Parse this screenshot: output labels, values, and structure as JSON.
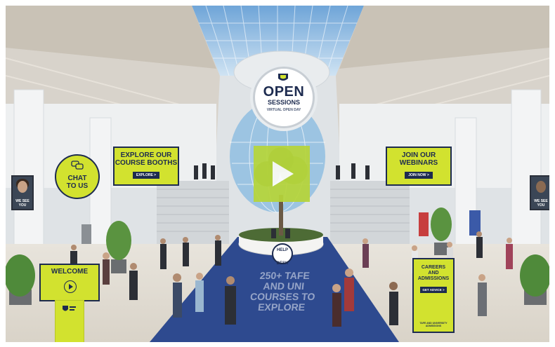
{
  "hub_sign": {
    "title": "OPEN",
    "subtitle": "SESSIONS",
    "tagline": "VIRTUAL OPEN DAY"
  },
  "video": {
    "icon": "play-icon"
  },
  "banners": {
    "explore": {
      "title_line1": "EXPLORE OUR",
      "title_line2": "COURSE BOOTHS",
      "button": "EXPLORE >"
    },
    "webinars": {
      "title_line1": "JOIN OUR",
      "title_line2": "WEBINARS",
      "button": "JOIN NOW >"
    }
  },
  "chat": {
    "line1": "CHAT",
    "line2": "TO US",
    "icon": "chat-bubbles-icon"
  },
  "portraits": {
    "left": {
      "caption_line1": "WE SEE",
      "caption_line2": "YOU"
    },
    "right": {
      "caption_line1": "WE SEE",
      "caption_line2": "YOU"
    }
  },
  "welcome": {
    "label": "WELCOME",
    "icon": "play-circle-icon"
  },
  "careers": {
    "line1": "CAREERS",
    "line2": "AND",
    "line3": "ADMISSIONS",
    "button": "GET ADVICE >",
    "note": "TAFE AND UNIVERSITY ADMISSIONS"
  },
  "help_desk": {
    "line1": "HELP",
    "line2": "DESK"
  },
  "floor": {
    "line1": "250+ TAFE",
    "line2": "AND UNI",
    "line3": "COURSES TO",
    "line4": "EXPLORE"
  },
  "colors": {
    "accent_yellow": "#d2e22f",
    "brand_navy": "#1d2b4f",
    "carpet_blue": "#2e4a8f",
    "play_green": "#b6d53a"
  }
}
